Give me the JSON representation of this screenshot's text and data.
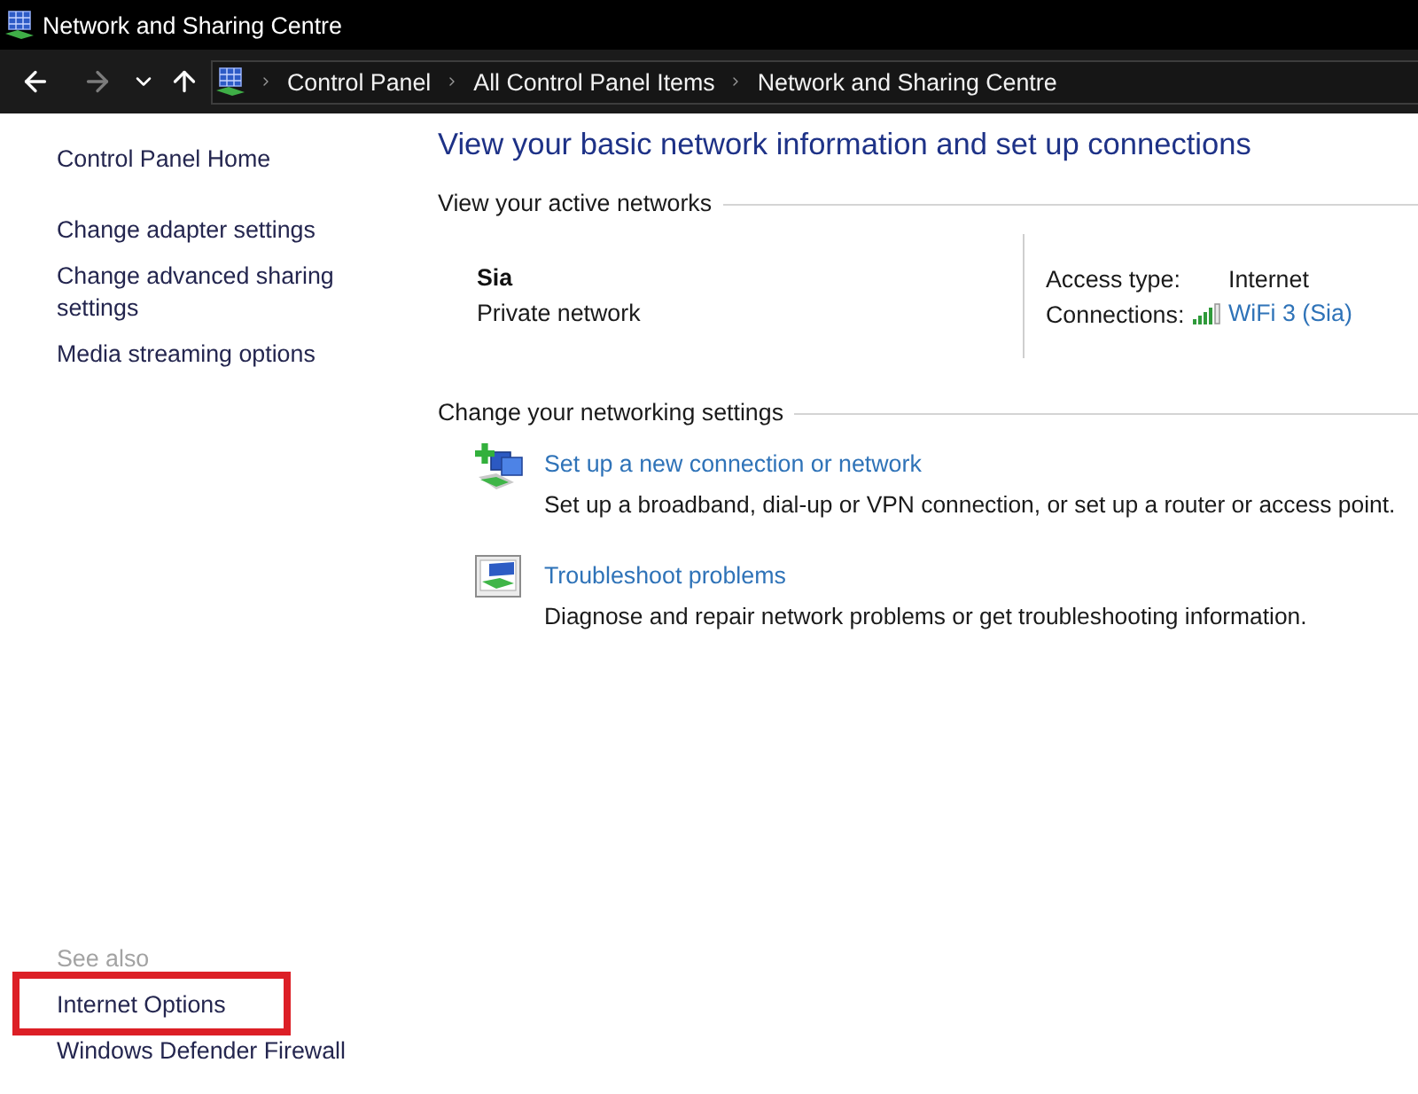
{
  "window": {
    "title": "Network and Sharing Centre"
  },
  "nav_buttons": [
    {
      "kind": "back",
      "disabled": false
    },
    {
      "kind": "forward",
      "disabled": true
    },
    {
      "kind": "recent",
      "disabled": false
    },
    {
      "kind": "up",
      "disabled": false
    }
  ],
  "address_bar": {
    "breadcrumbs": [
      "Control Panel",
      "All Control Panel Items",
      "Network and Sharing Centre"
    ]
  },
  "sidebar": {
    "home": "Control Panel Home",
    "items": [
      "Change adapter settings",
      "Change advanced sharing settings",
      "Media streaming options"
    ],
    "see_also": {
      "heading": "See also",
      "items": [
        {
          "label": "Internet Options",
          "highlighted": true
        },
        {
          "label": "Windows Defender Firewall",
          "highlighted": false
        }
      ]
    }
  },
  "main": {
    "heading": "View your basic network information and set up connections",
    "active_networks": {
      "heading": "View your active networks",
      "network": {
        "name": "Sia",
        "category": "Private network"
      },
      "access_type": {
        "label": "Access type:",
        "value": "Internet"
      },
      "connections": {
        "label": "Connections:",
        "value": "WiFi 3 (Sia)"
      }
    },
    "networking_settings": {
      "heading": "Change your networking settings",
      "tasks": [
        {
          "kind": "setup",
          "title": "Set up a new connection or network",
          "description": "Set up a broadband, dial-up or VPN connection, or set up a router or access point."
        },
        {
          "kind": "troubleshoot",
          "title": "Troubleshoot problems",
          "description": "Diagnose and repair network problems or get troubleshooting information."
        }
      ]
    }
  }
}
